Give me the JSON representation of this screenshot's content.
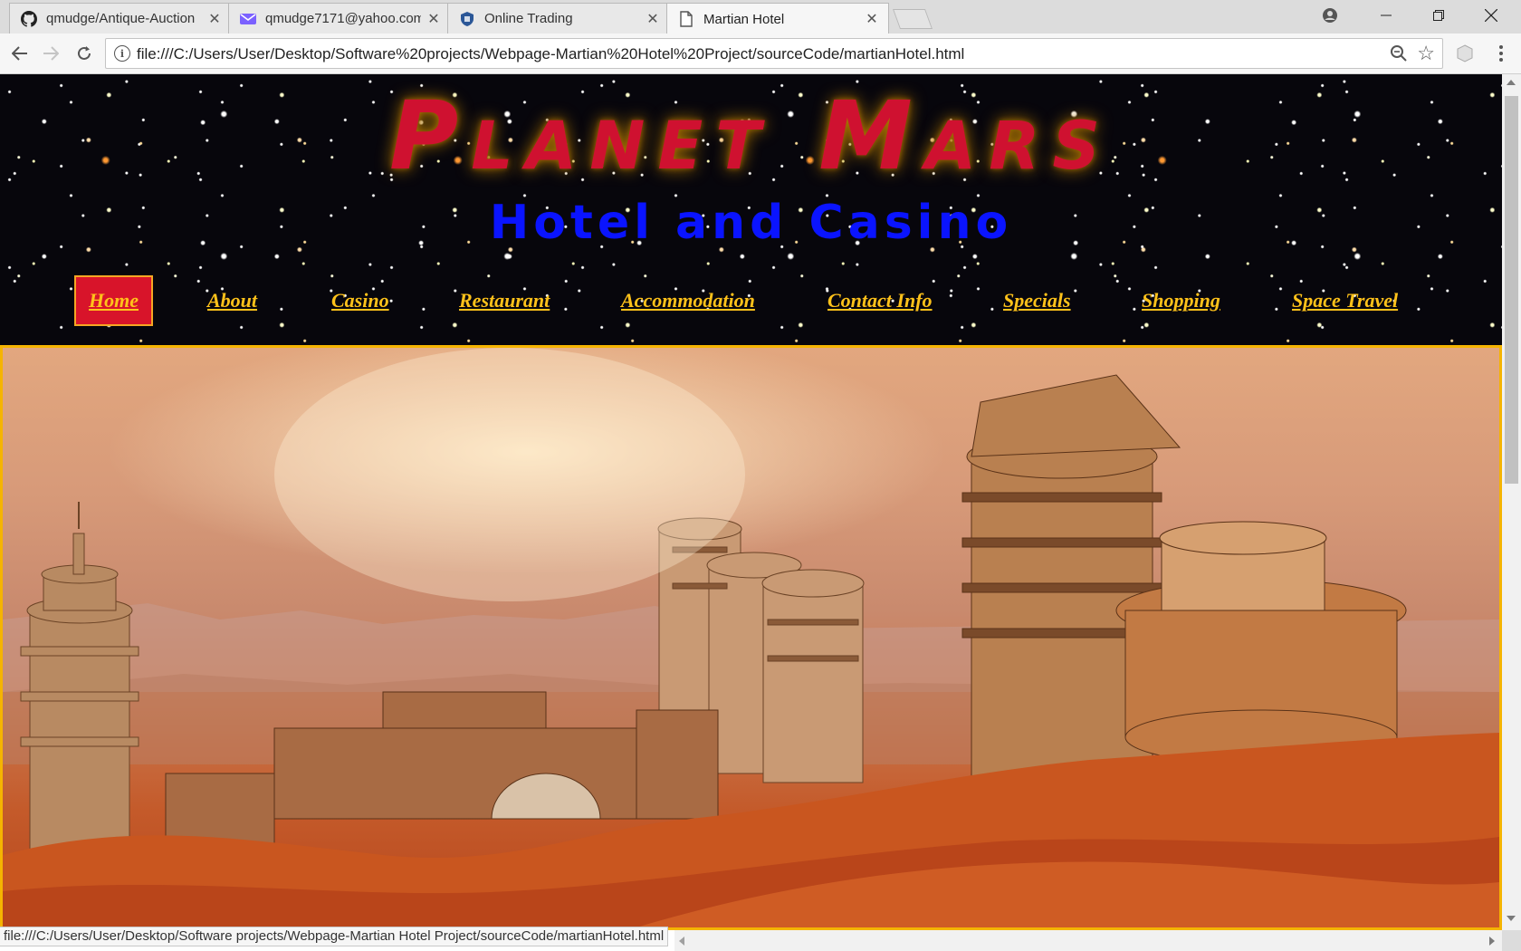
{
  "browser": {
    "tabs": [
      {
        "title": "qmudge/Antique-Auction",
        "icon": "github-icon"
      },
      {
        "title": "qmudge7171@yahoo.com",
        "icon": "mail-icon"
      },
      {
        "title": "Online Trading",
        "icon": "shield-icon"
      },
      {
        "title": "Martian Hotel",
        "icon": "page-icon"
      }
    ],
    "url": "file:///C:/Users/User/Desktop/Software%20projects/Webpage-Martian%20Hotel%20Project/sourceCode/martianHotel.html",
    "status_url": "file:///C:/Users/User/Desktop/Software projects/Webpage-Martian Hotel Project/sourceCode/martianHotel.html"
  },
  "page": {
    "title": "Planet Mars",
    "subtitle": "Hotel and Casino",
    "nav": [
      {
        "label": "Home",
        "active": true
      },
      {
        "label": "About"
      },
      {
        "label": "Casino"
      },
      {
        "label": "Restaurant"
      },
      {
        "label": "Accommodation"
      },
      {
        "label": "Contact Info"
      },
      {
        "label": "Specials"
      },
      {
        "label": "Shopping"
      },
      {
        "label": "Space Travel"
      }
    ]
  },
  "colors": {
    "title": "#cf1130",
    "subtitle": "#0a14ff",
    "nav_link": "#ffc21a",
    "nav_active_bg": "#d8142a",
    "hero_border": "#f5b400"
  }
}
